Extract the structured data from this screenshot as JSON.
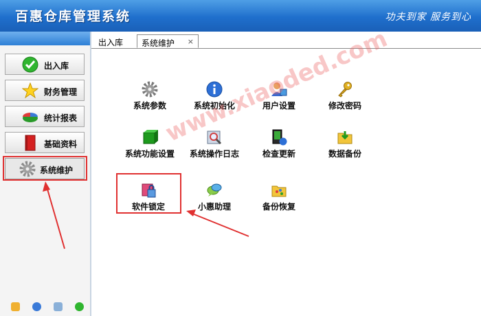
{
  "app": {
    "title": "百惠仓库管理系统",
    "slogan": "功夫到家 服务到心"
  },
  "sidebar": {
    "buttons": [
      {
        "label": "出入库",
        "icon": "green-check-icon"
      },
      {
        "label": "财务管理",
        "icon": "star-icon"
      },
      {
        "label": "统计报表",
        "icon": "pie-chart-icon"
      },
      {
        "label": "基础资料",
        "icon": "red-book-icon"
      },
      {
        "label": "系统维护",
        "icon": "gear-icon"
      }
    ],
    "bottom_icons": [
      "edit-icon",
      "clock-icon",
      "search-icon",
      "refresh-icon"
    ]
  },
  "tabs": [
    {
      "label": "出入库"
    },
    {
      "label": "系统维护",
      "close": "×"
    }
  ],
  "main": {
    "items": [
      {
        "label": "系统参数",
        "icon": "gear-icon"
      },
      {
        "label": "系统初始化",
        "icon": "info-icon"
      },
      {
        "label": "用户设置",
        "icon": "user-icon"
      },
      {
        "label": "修改密码",
        "icon": "key-icon"
      },
      {
        "label": "系统功能设置",
        "icon": "green-box-icon"
      },
      {
        "label": "系统操作日志",
        "icon": "log-search-icon"
      },
      {
        "label": "检查更新",
        "icon": "update-icon"
      },
      {
        "label": "数据备份",
        "icon": "folder-backup-icon"
      },
      {
        "label": "软件锁定",
        "icon": "lock-icon"
      },
      {
        "label": "小惠助理",
        "icon": "chat-bubble-icon"
      },
      {
        "label": "备份恢复",
        "icon": "folder-restore-icon"
      }
    ]
  },
  "watermark": "www.xiaoded.com",
  "colors": {
    "highlight": "#e03030",
    "titlebar": "#1f6fcc"
  }
}
